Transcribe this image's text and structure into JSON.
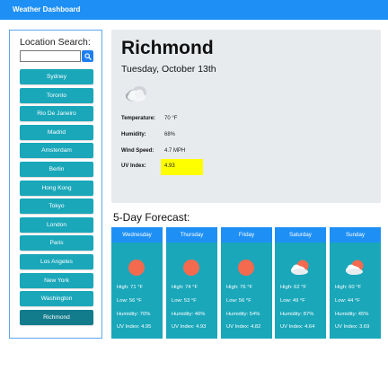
{
  "navbar": {
    "title": "Weather Dashboard"
  },
  "sidebar": {
    "title": "Location Search:",
    "search": {
      "value": "",
      "placeholder": ""
    },
    "cities": [
      "Sydney",
      "Toronto",
      "Rio De Janeiro",
      "Madrid",
      "Amsterdam",
      "Berlin",
      "Hong Kong",
      "Tokyo",
      "London",
      "Paris",
      "Los Angeles",
      "New York",
      "Washington",
      "Richmond"
    ],
    "active_city": "Richmond"
  },
  "current": {
    "city": "Richmond",
    "date": "Tuesday, October 13th",
    "icon": "cloudy-icon",
    "temperature_label": "Temperature:",
    "temperature": "70 °F",
    "humidity_label": "Humidity:",
    "humidity": "68%",
    "wind_label": "Wind Speed:",
    "wind": "4.7 MPH",
    "uv_label": "UV Index:",
    "uv": "4.93",
    "uv_color": "#ffff00"
  },
  "forecast": {
    "title": "5-Day Forecast:",
    "days": [
      {
        "day": "Wednesday",
        "icon": "sun-icon",
        "high": "High: 71 °F",
        "low": "Low: 56 °F",
        "humidity": "Humidity: 70%",
        "uv": "UV Index: 4.95"
      },
      {
        "day": "Thursday",
        "icon": "sun-icon",
        "high": "High: 74 °F",
        "low": "Low: 53 °F",
        "humidity": "Humidity: 46%",
        "uv": "UV Index: 4.93"
      },
      {
        "day": "Friday",
        "icon": "sun-icon",
        "high": "High: 76 °F",
        "low": "Low: 56 °F",
        "humidity": "Humidity: 54%",
        "uv": "UV Index: 4.82"
      },
      {
        "day": "Saturday",
        "icon": "partly-cloudy-icon",
        "high": "High: 62 °F",
        "low": "Low: 49 °F",
        "humidity": "Humidity: 87%",
        "uv": "UV Index: 4.64"
      },
      {
        "day": "Sunday",
        "icon": "partly-cloudy-icon",
        "high": "High: 60 °F",
        "low": "Low: 44 °F",
        "humidity": "Humidity: 45%",
        "uv": "UV Index: 3.69"
      }
    ]
  },
  "colors": {
    "navbar": "#1e90f5",
    "city_button": "#1aa7ba",
    "city_button_active": "#137c8c",
    "card_body": "#1aa7ba",
    "card_header": "#1e90f5",
    "sun": "#f36a4f"
  }
}
